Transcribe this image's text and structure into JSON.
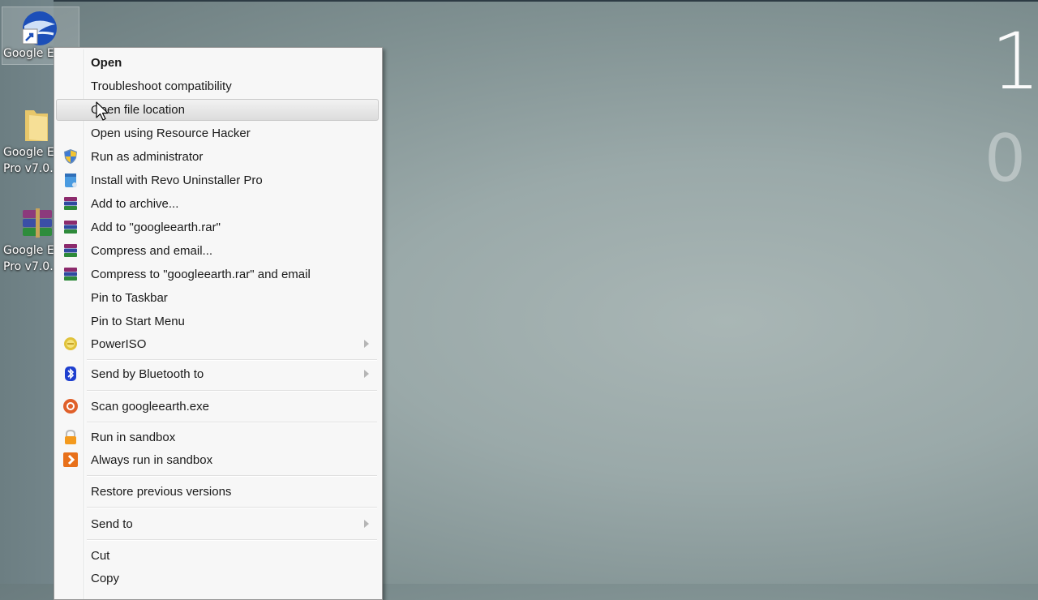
{
  "desktop": {
    "icons": [
      {
        "name": "google-earth-shortcut",
        "label_lines": [
          "Google E"
        ],
        "icon": "google-earth-globe-icon"
      },
      {
        "name": "google-earth-folder",
        "label_lines": [
          "Google E",
          "Pro v7.0."
        ],
        "icon": "folder-icon"
      },
      {
        "name": "google-earth-archive",
        "label_lines": [
          "Google E",
          "Pro v7.0."
        ],
        "icon": "winrar-archive-icon"
      }
    ],
    "clock": {
      "hour": "1",
      "minute": "0"
    }
  },
  "context_menu": {
    "items": [
      {
        "label": "Open",
        "bold": true,
        "icon": null,
        "submenu": false
      },
      {
        "label": "Troubleshoot compatibility",
        "icon": null,
        "submenu": false
      },
      {
        "label": "Open file location",
        "icon": null,
        "submenu": false,
        "highlighted": true
      },
      {
        "label": "Open using Resource Hacker",
        "icon": null,
        "submenu": false
      },
      {
        "label": "Run as administrator",
        "icon": "uac-shield-icon",
        "submenu": false
      },
      {
        "label": "Install with Revo Uninstaller Pro",
        "icon": "revo-uninstaller-icon",
        "submenu": false
      },
      {
        "label": "Add to archive...",
        "icon": "winrar-icon",
        "submenu": false
      },
      {
        "label": "Add to \"googleearth.rar\"",
        "icon": "winrar-icon",
        "submenu": false
      },
      {
        "label": "Compress and email...",
        "icon": "winrar-icon",
        "submenu": false
      },
      {
        "label": "Compress to \"googleearth.rar\" and email",
        "icon": "winrar-icon",
        "submenu": false
      },
      {
        "label": "Pin to Taskbar",
        "icon": null,
        "submenu": false
      },
      {
        "label": "Pin to Start Menu",
        "icon": null,
        "submenu": false
      },
      {
        "label": "PowerISO",
        "icon": "poweriso-icon",
        "submenu": true
      },
      {
        "label": "Send by Bluetooth to",
        "icon": "bluetooth-icon",
        "submenu": true
      },
      {
        "label": "Scan googleearth.exe",
        "icon": "avast-scan-icon",
        "submenu": false
      },
      {
        "label": "Run in sandbox",
        "icon": "sandbox-lock-icon",
        "submenu": false
      },
      {
        "label": "Always run in sandbox",
        "icon": "sandbox-arrow-icon",
        "submenu": false
      },
      {
        "label": "Restore previous versions",
        "icon": null,
        "submenu": false
      },
      {
        "label": "Send to",
        "icon": null,
        "submenu": true
      },
      {
        "label": "Cut",
        "icon": null,
        "submenu": false
      },
      {
        "label": "Copy",
        "icon": null,
        "submenu": false
      }
    ]
  }
}
